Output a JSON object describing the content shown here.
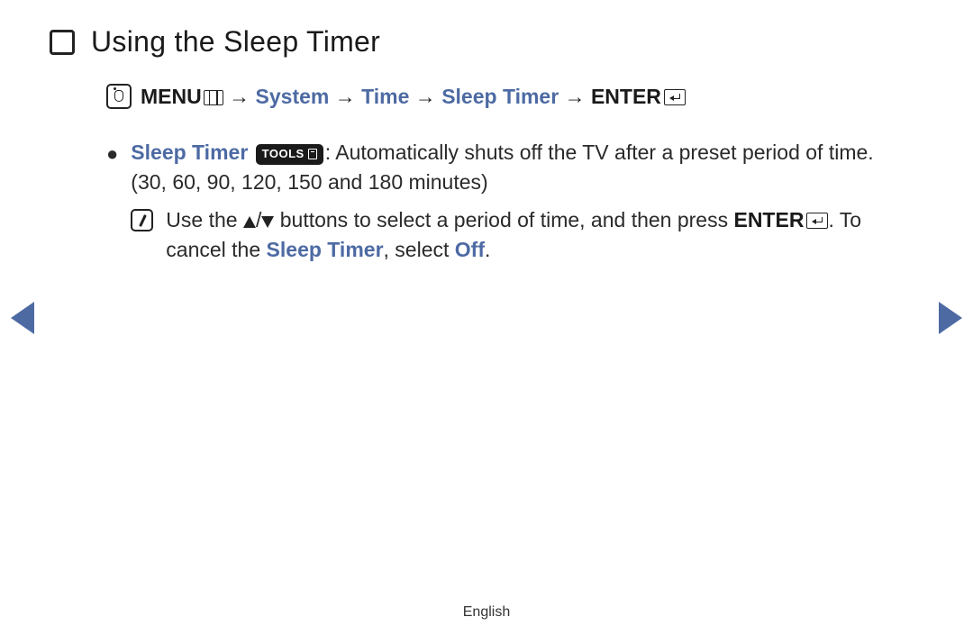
{
  "colors": {
    "link": "#4d6aa3",
    "text": "#1a1a1a"
  },
  "header": {
    "title": "Using the Sleep Timer"
  },
  "path": {
    "menu": "MENU",
    "arrow": "→",
    "step1": "System",
    "step2": "Time",
    "step3": "Sleep Timer",
    "enter": "ENTER"
  },
  "bullet": {
    "label": "Sleep Timer",
    "tools": "TOOLS",
    "desc1": ": Automatically shuts off the TV after a preset period of time. (30, 60, 90, 120, 150 and 180 minutes)"
  },
  "note": {
    "part1": "Use the ",
    "slash": "/",
    "part2": " buttons to select a period of time, and then press ",
    "enter": "ENTER",
    "part3": ". To cancel the ",
    "link1": "Sleep Timer",
    "part4": ", select ",
    "link2": "Off",
    "part5": "."
  },
  "footer": {
    "language": "English"
  }
}
